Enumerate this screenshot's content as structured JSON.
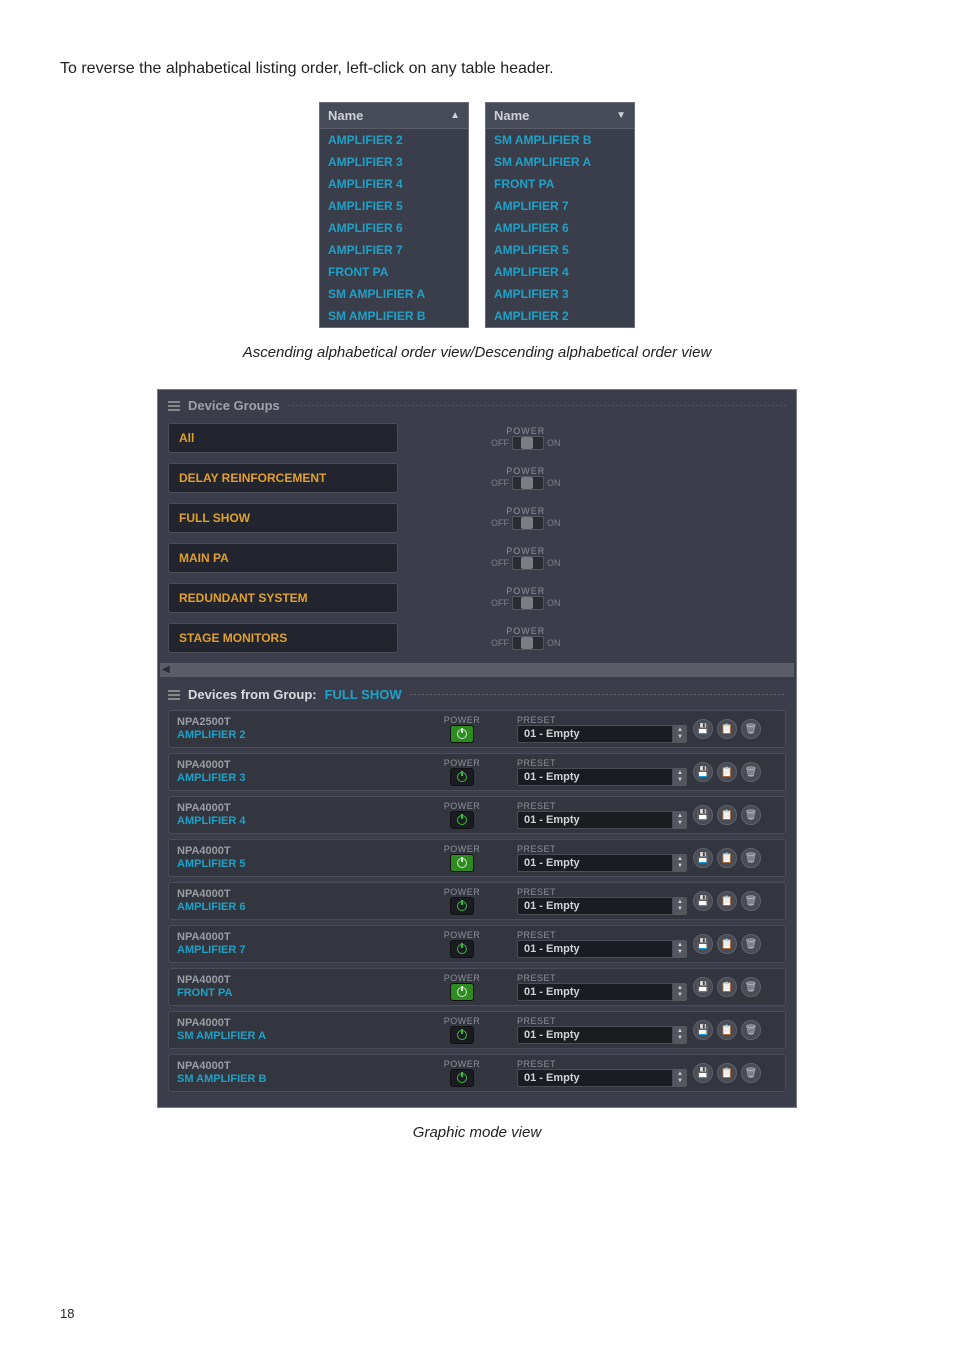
{
  "intro_text": "To reverse the alphabetical listing order, left-click on any table header.",
  "name_header": "Name",
  "table_asc": [
    "AMPLIFIER 2",
    "AMPLIFIER 3",
    "AMPLIFIER 4",
    "AMPLIFIER 5",
    "AMPLIFIER 6",
    "AMPLIFIER 7",
    "FRONT PA",
    "SM AMPLIFIER A",
    "SM AMPLIFIER B"
  ],
  "table_desc": [
    "SM AMPLIFIER B",
    "SM AMPLIFIER A",
    "FRONT PA",
    "AMPLIFIER 7",
    "AMPLIFIER 6",
    "AMPLIFIER 5",
    "AMPLIFIER 4",
    "AMPLIFIER 3",
    "AMPLIFIER 2"
  ],
  "caption1": "Ascending alphabetical order view/Descending alphabetical order view",
  "panel": {
    "groups_title": "Device Groups",
    "devices_title_prefix": "Devices from Group:",
    "devices_title_group": "FULL SHOW",
    "power_label": "POWER",
    "off": "OFF",
    "on": "ON",
    "preset_label": "PRESET",
    "groups": [
      {
        "name": "All"
      },
      {
        "name": "DELAY REINFORCEMENT"
      },
      {
        "name": "FULL SHOW"
      },
      {
        "name": "MAIN PA"
      },
      {
        "name": "REDUNDANT SYSTEM"
      },
      {
        "name": "STAGE MONITORS"
      }
    ],
    "devices": [
      {
        "model": "NPA2500T",
        "name": "AMPLIFIER 2",
        "power_on": true,
        "preset": "01 - Empty"
      },
      {
        "model": "NPA4000T",
        "name": "AMPLIFIER 3",
        "power_on": false,
        "preset": "01 - Empty"
      },
      {
        "model": "NPA4000T",
        "name": "AMPLIFIER 4",
        "power_on": false,
        "preset": "01 - Empty"
      },
      {
        "model": "NPA4000T",
        "name": "AMPLIFIER 5",
        "power_on": true,
        "preset": "01 - Empty"
      },
      {
        "model": "NPA4000T",
        "name": "AMPLIFIER 6",
        "power_on": false,
        "preset": "01 - Empty"
      },
      {
        "model": "NPA4000T",
        "name": "AMPLIFIER 7",
        "power_on": false,
        "preset": "01 - Empty"
      },
      {
        "model": "NPA4000T",
        "name": "FRONT PA",
        "power_on": true,
        "preset": "01 - Empty"
      },
      {
        "model": "NPA4000T",
        "name": "SM AMPLIFIER A",
        "power_on": false,
        "preset": "01 - Empty"
      },
      {
        "model": "NPA4000T",
        "name": "SM AMPLIFIER B",
        "power_on": false,
        "preset": "01 - Empty"
      }
    ]
  },
  "caption2": "Graphic mode view",
  "page_number": "18"
}
